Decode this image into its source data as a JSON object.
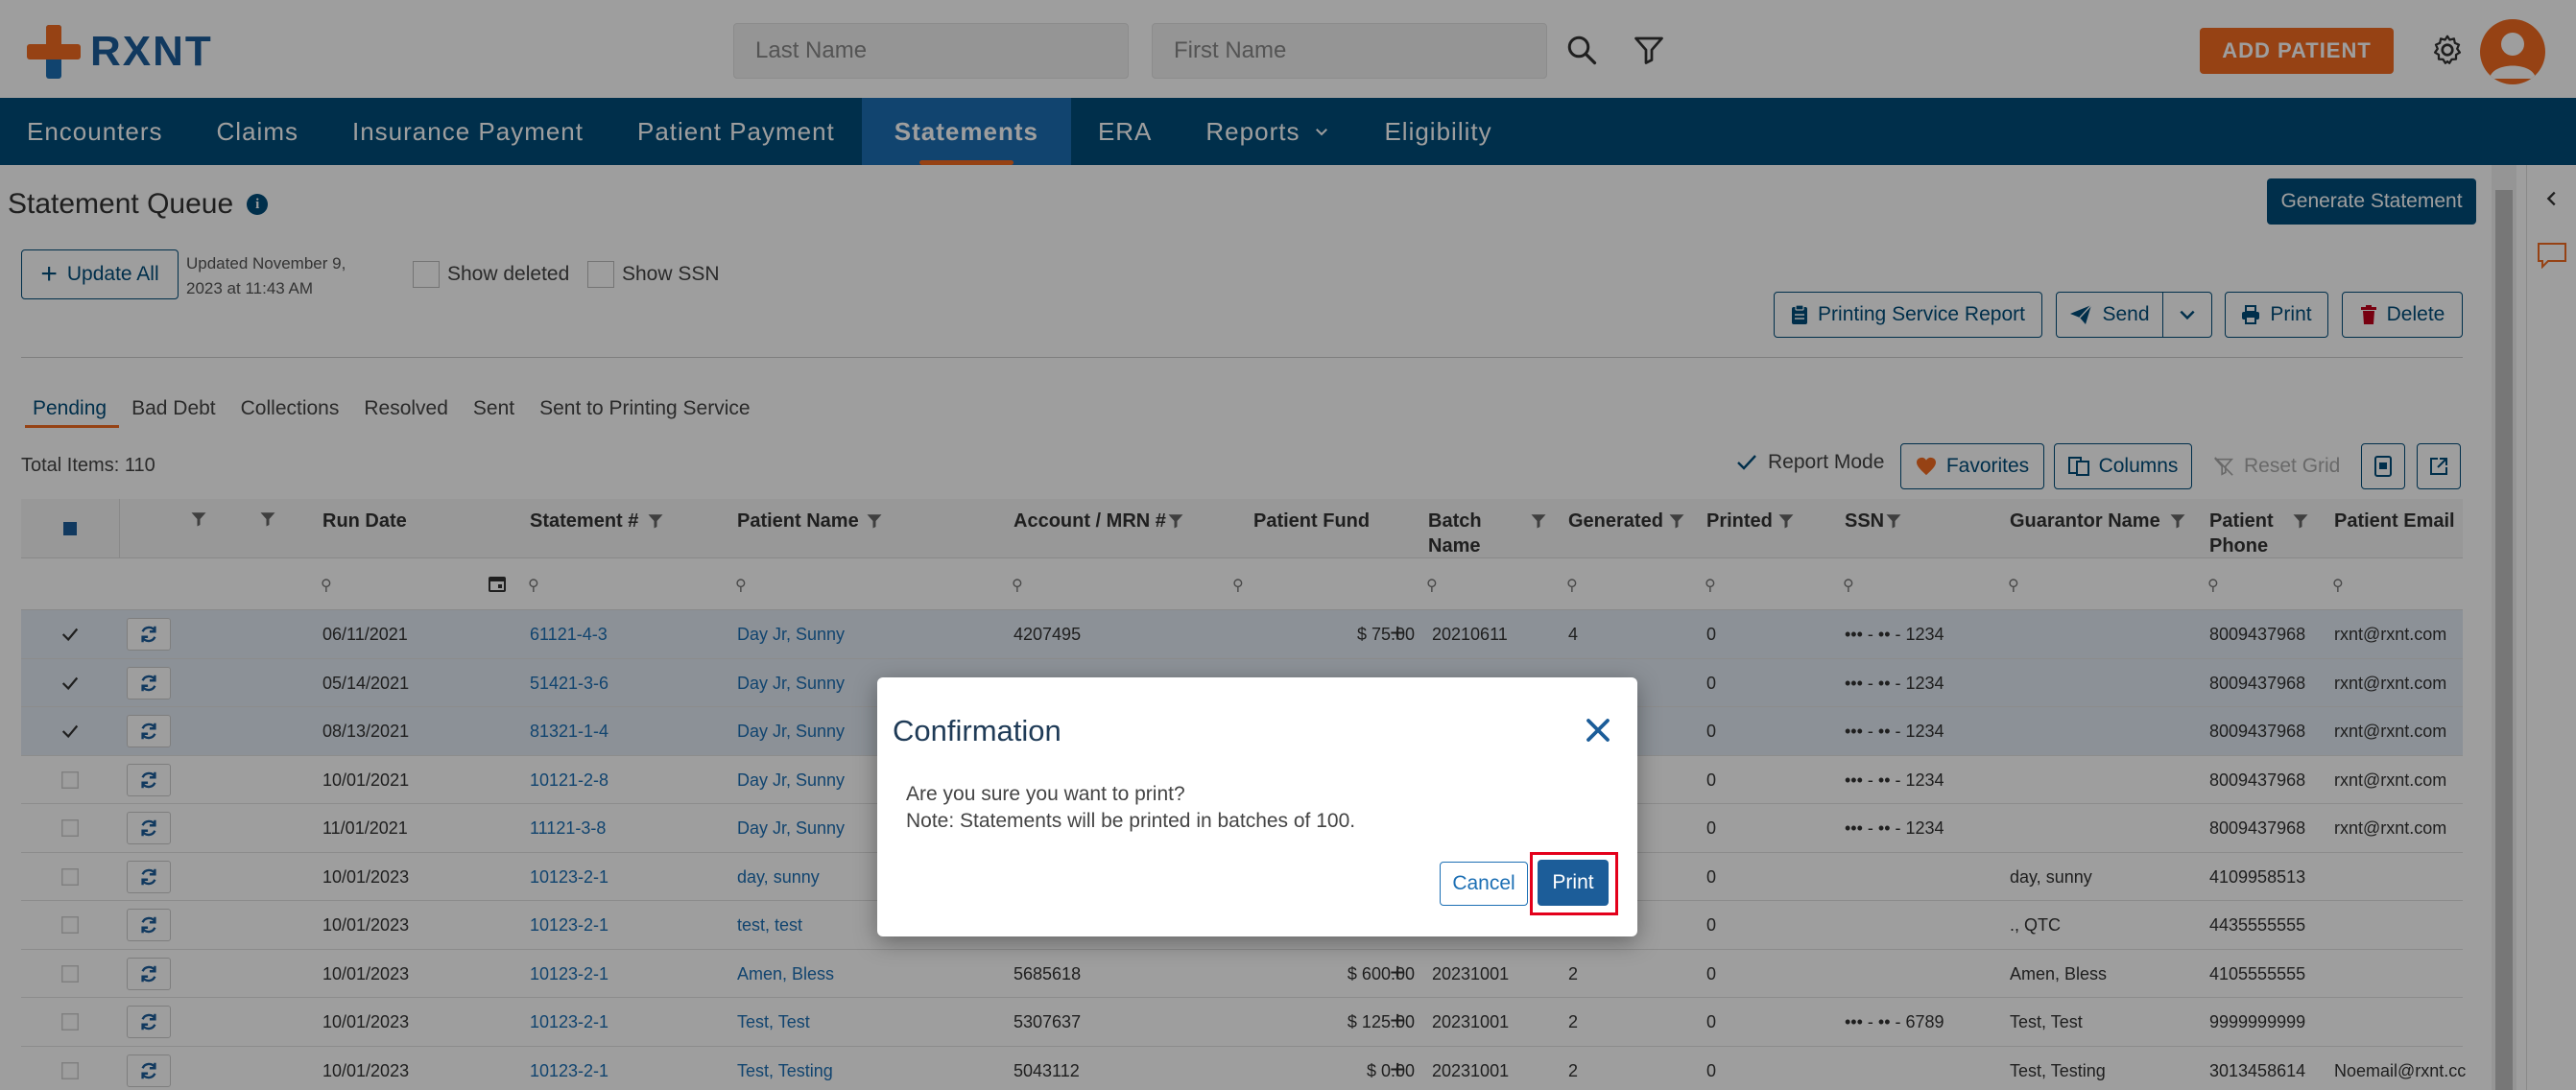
{
  "header": {
    "logo_text": "RXNT",
    "last_name_placeholder": "Last Name",
    "first_name_placeholder": "First Name",
    "add_patient_label": "ADD PATIENT"
  },
  "nav": {
    "items": [
      "Encounters",
      "Claims",
      "Insurance Payment",
      "Patient Payment",
      "Statements",
      "ERA",
      "Reports",
      "Eligibility"
    ],
    "active": "Statements"
  },
  "page": {
    "title": "Statement Queue",
    "generate_label": "Generate Statement",
    "update_all_label": "Update All",
    "updated_text": "Updated November 9, 2023 at 11:43 AM",
    "show_deleted_label": "Show deleted",
    "show_ssn_label": "Show SSN",
    "printing_service_report_label": "Printing Service Report",
    "send_label": "Send",
    "print_label": "Print",
    "delete_label": "Delete"
  },
  "tabs": [
    "Pending",
    "Bad Debt",
    "Collections",
    "Resolved",
    "Sent",
    "Sent to Printing Service"
  ],
  "grid": {
    "total_items": "Total Items: 110",
    "report_mode_label": "Report Mode",
    "favorites_label": "Favorites",
    "columns_label": "Columns",
    "reset_grid_label": "Reset Grid"
  },
  "table": {
    "headers": {
      "run_date": "Run Date",
      "statement": "Statement #",
      "patient_name": "Patient Name",
      "account": "Account / MRN #",
      "patient_fund": "Patient Fund",
      "batch_name": "Batch Name",
      "generated": "Generated",
      "printed": "Printed",
      "ssn": "SSN",
      "guarantor": "Guarantor Name",
      "phone": "Patient Phone",
      "email": "Patient Email"
    },
    "rows": [
      {
        "run_date": "06/11/2021",
        "statement": "61121-4-3",
        "patient": "Day Jr, Sunny",
        "account": "4207495",
        "fund": "$ 75.00",
        "batch": "20210611",
        "generated": "4",
        "printed": "0",
        "ssn": "••• - •• - 1234",
        "guarantor": "",
        "phone": "8009437968",
        "email": "rxnt@rxnt.com"
      },
      {
        "run_date": "05/14/2021",
        "statement": "51421-3-6",
        "patient": "Day Jr, Sunny",
        "account": "",
        "fund": "",
        "batch": "",
        "generated": "",
        "printed": "0",
        "ssn": "••• - •• - 1234",
        "guarantor": "",
        "phone": "8009437968",
        "email": "rxnt@rxnt.com"
      },
      {
        "run_date": "08/13/2021",
        "statement": "81321-1-4",
        "patient": "Day Jr, Sunny",
        "account": "",
        "fund": "",
        "batch": "",
        "generated": "",
        "printed": "0",
        "ssn": "••• - •• - 1234",
        "guarantor": "",
        "phone": "8009437968",
        "email": "rxnt@rxnt.com"
      },
      {
        "run_date": "10/01/2021",
        "statement": "10121-2-8",
        "patient": "Day Jr, Sunny",
        "account": "",
        "fund": "",
        "batch": "",
        "generated": "",
        "printed": "0",
        "ssn": "••• - •• - 1234",
        "guarantor": "",
        "phone": "8009437968",
        "email": "rxnt@rxnt.com"
      },
      {
        "run_date": "11/01/2021",
        "statement": "11121-3-8",
        "patient": "Day Jr, Sunny",
        "account": "",
        "fund": "",
        "batch": "",
        "generated": "",
        "printed": "0",
        "ssn": "••• - •• - 1234",
        "guarantor": "",
        "phone": "8009437968",
        "email": "rxnt@rxnt.com"
      },
      {
        "run_date": "10/01/2023",
        "statement": "10123-2-1",
        "patient": "day, sunny",
        "account": "",
        "fund": "",
        "batch": "",
        "generated": "",
        "printed": "0",
        "ssn": "",
        "guarantor": "day, sunny",
        "phone": "4109958513",
        "email": ""
      },
      {
        "run_date": "10/01/2023",
        "statement": "10123-2-1",
        "patient": "test, test",
        "account": "",
        "fund": "",
        "batch": "",
        "generated": "",
        "printed": "0",
        "ssn": "",
        "guarantor": "., QTC",
        "phone": "4435555555",
        "email": ""
      },
      {
        "run_date": "10/01/2023",
        "statement": "10123-2-1",
        "patient": "Amen, Bless",
        "account": "5685618",
        "fund": "$ 600.00",
        "batch": "20231001",
        "generated": "2",
        "printed": "0",
        "ssn": "",
        "guarantor": "Amen, Bless",
        "phone": "4105555555",
        "email": ""
      },
      {
        "run_date": "10/01/2023",
        "statement": "10123-2-1",
        "patient": "Test, Test",
        "account": "5307637",
        "fund": "$ 125.00",
        "batch": "20231001",
        "generated": "2",
        "printed": "0",
        "ssn": "••• - •• - 6789",
        "guarantor": "Test, Test",
        "phone": "9999999999",
        "email": ""
      },
      {
        "run_date": "10/01/2023",
        "statement": "10123-2-1",
        "patient": "Test, Testing",
        "account": "5043112",
        "fund": "$ 0.00",
        "batch": "20231001",
        "generated": "2",
        "printed": "0",
        "ssn": "",
        "guarantor": "Test, Testing",
        "phone": "3013458614",
        "email": "Noemail@rxnt.cc"
      }
    ]
  },
  "modal": {
    "title": "Confirmation",
    "line1": "Are you sure you want to print?",
    "line2": "Note: Statements will be printed in batches of 100.",
    "cancel_label": "Cancel",
    "print_label": "Print"
  },
  "colors": {
    "nav_bg": "#004c7a",
    "nav_active": "#1c6fb4",
    "accent": "#f26b21",
    "link": "#1c6fb4",
    "highlight_border": "#e3001b"
  }
}
